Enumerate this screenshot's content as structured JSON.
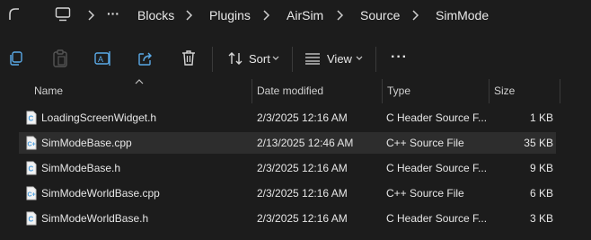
{
  "address_bar": {
    "ellipsis": "···",
    "crumbs": [
      "Blocks",
      "Plugins",
      "AirSim",
      "Source",
      "SimMode"
    ]
  },
  "toolbar": {
    "sort_label": "Sort",
    "view_label": "View",
    "more_label": "···"
  },
  "columns": {
    "name": "Name",
    "date": "Date modified",
    "type": "Type",
    "size": "Size"
  },
  "files": [
    {
      "name": "LoadingScreenWidget.h",
      "date": "2/3/2025 12:16 AM",
      "type": "C Header Source F...",
      "size": "1 KB"
    },
    {
      "name": "SimModeBase.cpp",
      "date": "2/13/2025 12:46 AM",
      "type": "C++ Source File",
      "size": "35 KB"
    },
    {
      "name": "SimModeBase.h",
      "date": "2/3/2025 12:16 AM",
      "type": "C Header Source F...",
      "size": "9 KB"
    },
    {
      "name": "SimModeWorldBase.cpp",
      "date": "2/3/2025 12:16 AM",
      "type": "C++ Source File",
      "size": "6 KB"
    },
    {
      "name": "SimModeWorldBase.h",
      "date": "2/3/2025 12:16 AM",
      "type": "C Header Source F...",
      "size": "3 KB"
    }
  ],
  "colors": {
    "background": "#1c1c1c",
    "selected_row": "#2d2d2d",
    "file_icon_accent": "#4a9fe0"
  }
}
